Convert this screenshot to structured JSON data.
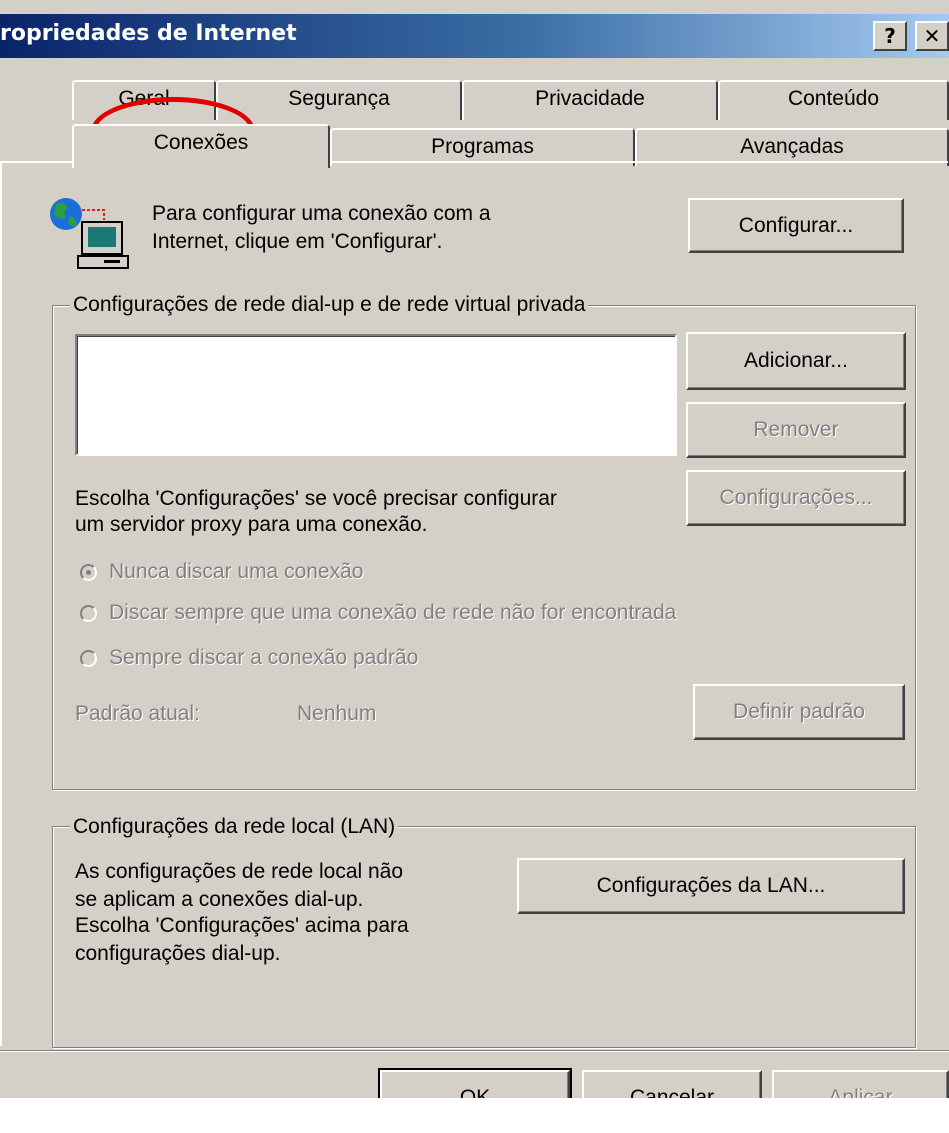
{
  "window": {
    "title": "ropriedades de Internet",
    "help_glyph": "?",
    "close_glyph": "✕"
  },
  "tabs": {
    "row1": [
      "Geral",
      "Segurança",
      "Privacidade",
      "Conteúdo"
    ],
    "row2": [
      "Conexões",
      "Programas",
      "Avançadas"
    ],
    "active": "Conexões"
  },
  "setup": {
    "text_line1": "Para configurar uma conexão com a",
    "text_line2": "Internet, clique em 'Configurar'.",
    "button": "Configurar..."
  },
  "dialup": {
    "legend": "Configurações de rede dial-up e de rede virtual privada",
    "add_button": "Adicionar...",
    "remove_button": "Remover",
    "proxy_text_line1": "Escolha 'Configurações' se você precisar configurar",
    "proxy_text_line2": "um servidor proxy para uma conexão.",
    "settings_button": "Configurações...",
    "radio_never": "Nunca discar uma conexão",
    "radio_when_needed": "Discar sempre que uma conexão de rede não for encontrada",
    "radio_always": "Sempre discar a conexão padrão",
    "current_default_label": "Padrão atual:",
    "current_default_value": "Nenhum",
    "set_default_button": "Definir padrão"
  },
  "lan": {
    "legend": "Configurações da rede local (LAN)",
    "text_line1": "As configurações de rede local não",
    "text_line2": "se aplicam a conexões dial-up.",
    "text_line3": "Escolha 'Configurações' acima para",
    "text_line4": "configurações dial-up.",
    "button": "Configurações da LAN..."
  },
  "footer": {
    "ok": "OK",
    "cancel": "Cancelar",
    "apply": "Aplicar"
  },
  "colors": {
    "dialog_face": "#d4d0c8",
    "titlebar_start": "#0a246a",
    "titlebar_end": "#a6caf0",
    "annotation": "#e00000",
    "disabled_text": "#808080"
  }
}
